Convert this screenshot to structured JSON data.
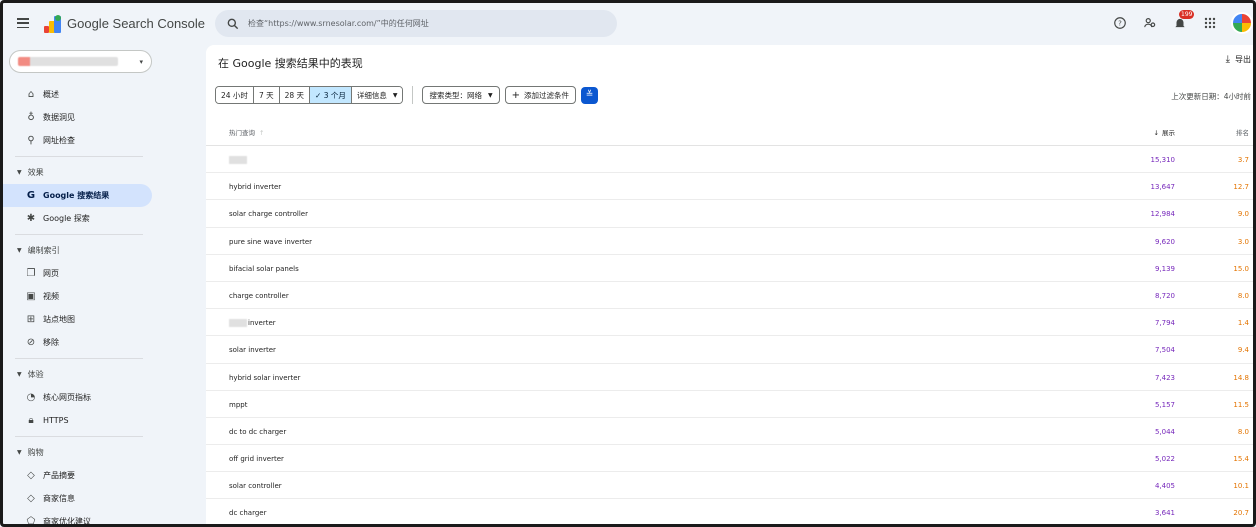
{
  "app": {
    "title": "Google Search Console",
    "search_placeholder": "检查“https://www.srnesolar.com/”中的任何网址",
    "notification_count": "199"
  },
  "colors": {
    "impressions": "#7627bb",
    "position": "#e37400",
    "active_nav": "#d3e3fd",
    "filter_button": "#0b57d0"
  },
  "sidebar": {
    "top_items": [
      {
        "icon": "home-icon",
        "label": "概述"
      },
      {
        "icon": "insights-icon",
        "label": "数据洞见"
      },
      {
        "icon": "search-icon",
        "label": "网址检查"
      }
    ],
    "sections": [
      {
        "label": "效果",
        "items": [
          {
            "icon": "google-g-icon",
            "label": "Google 搜索结果",
            "active": true
          },
          {
            "icon": "discover-icon",
            "label": "Google 探索"
          }
        ]
      },
      {
        "label": "编制索引",
        "items": [
          {
            "icon": "pages-icon",
            "label": "网页"
          },
          {
            "icon": "video-icon",
            "label": "视频"
          },
          {
            "icon": "sitemap-icon",
            "label": "站点地图"
          },
          {
            "icon": "removals-icon",
            "label": "移除"
          }
        ]
      },
      {
        "label": "体验",
        "items": [
          {
            "icon": "gauge-icon",
            "label": "核心网页指标"
          },
          {
            "icon": "lock-icon",
            "label": "HTTPS"
          }
        ]
      },
      {
        "label": "购物",
        "items": [
          {
            "icon": "diamond-icon",
            "label": "产品摘要"
          },
          {
            "icon": "diamond-icon",
            "label": "商家信息"
          },
          {
            "icon": "tag-icon",
            "label": "商家优化建议"
          }
        ]
      }
    ]
  },
  "main": {
    "title": "在 Google 搜索结果中的表现",
    "export_label": "导出",
    "date_ranges": [
      "24 小时",
      "7 天",
      "28 天",
      "3 个月",
      "详细信息"
    ],
    "selected_range": "✓ 3 个月",
    "search_type": "搜索类型：网络",
    "add_filter": "添加过滤条件",
    "updated": "上次更新日期：4小时前"
  },
  "table": {
    "headers": {
      "query": "热门查询",
      "impressions": "展示",
      "position": "排名"
    },
    "rows": [
      {
        "query": "",
        "masked": true,
        "impressions": "15,310",
        "position": "3.7"
      },
      {
        "query": "hybrid inverter",
        "impressions": "13,647",
        "position": "12.7"
      },
      {
        "query": "solar charge controller",
        "impressions": "12,984",
        "position": "9.0"
      },
      {
        "query": "pure sine wave inverter",
        "impressions": "9,620",
        "position": "3.0"
      },
      {
        "query": "bifacial solar panels",
        "impressions": "9,139",
        "position": "15.0"
      },
      {
        "query": "charge controller",
        "impressions": "8,720",
        "position": "8.0"
      },
      {
        "query": "inverter",
        "masked": true,
        "impressions": "7,794",
        "position": "1.4"
      },
      {
        "query": "solar inverter",
        "impressions": "7,504",
        "position": "9.4"
      },
      {
        "query": "hybrid solar inverter",
        "impressions": "7,423",
        "position": "14.8"
      },
      {
        "query": "mppt",
        "impressions": "5,157",
        "position": "11.5"
      },
      {
        "query": "dc to dc charger",
        "impressions": "5,044",
        "position": "8.0"
      },
      {
        "query": "off grid inverter",
        "impressions": "5,022",
        "position": "15.4"
      },
      {
        "query": "solar controller",
        "impressions": "4,405",
        "position": "10.1"
      },
      {
        "query": "dc charger",
        "impressions": "3,641",
        "position": "20.7"
      }
    ]
  }
}
